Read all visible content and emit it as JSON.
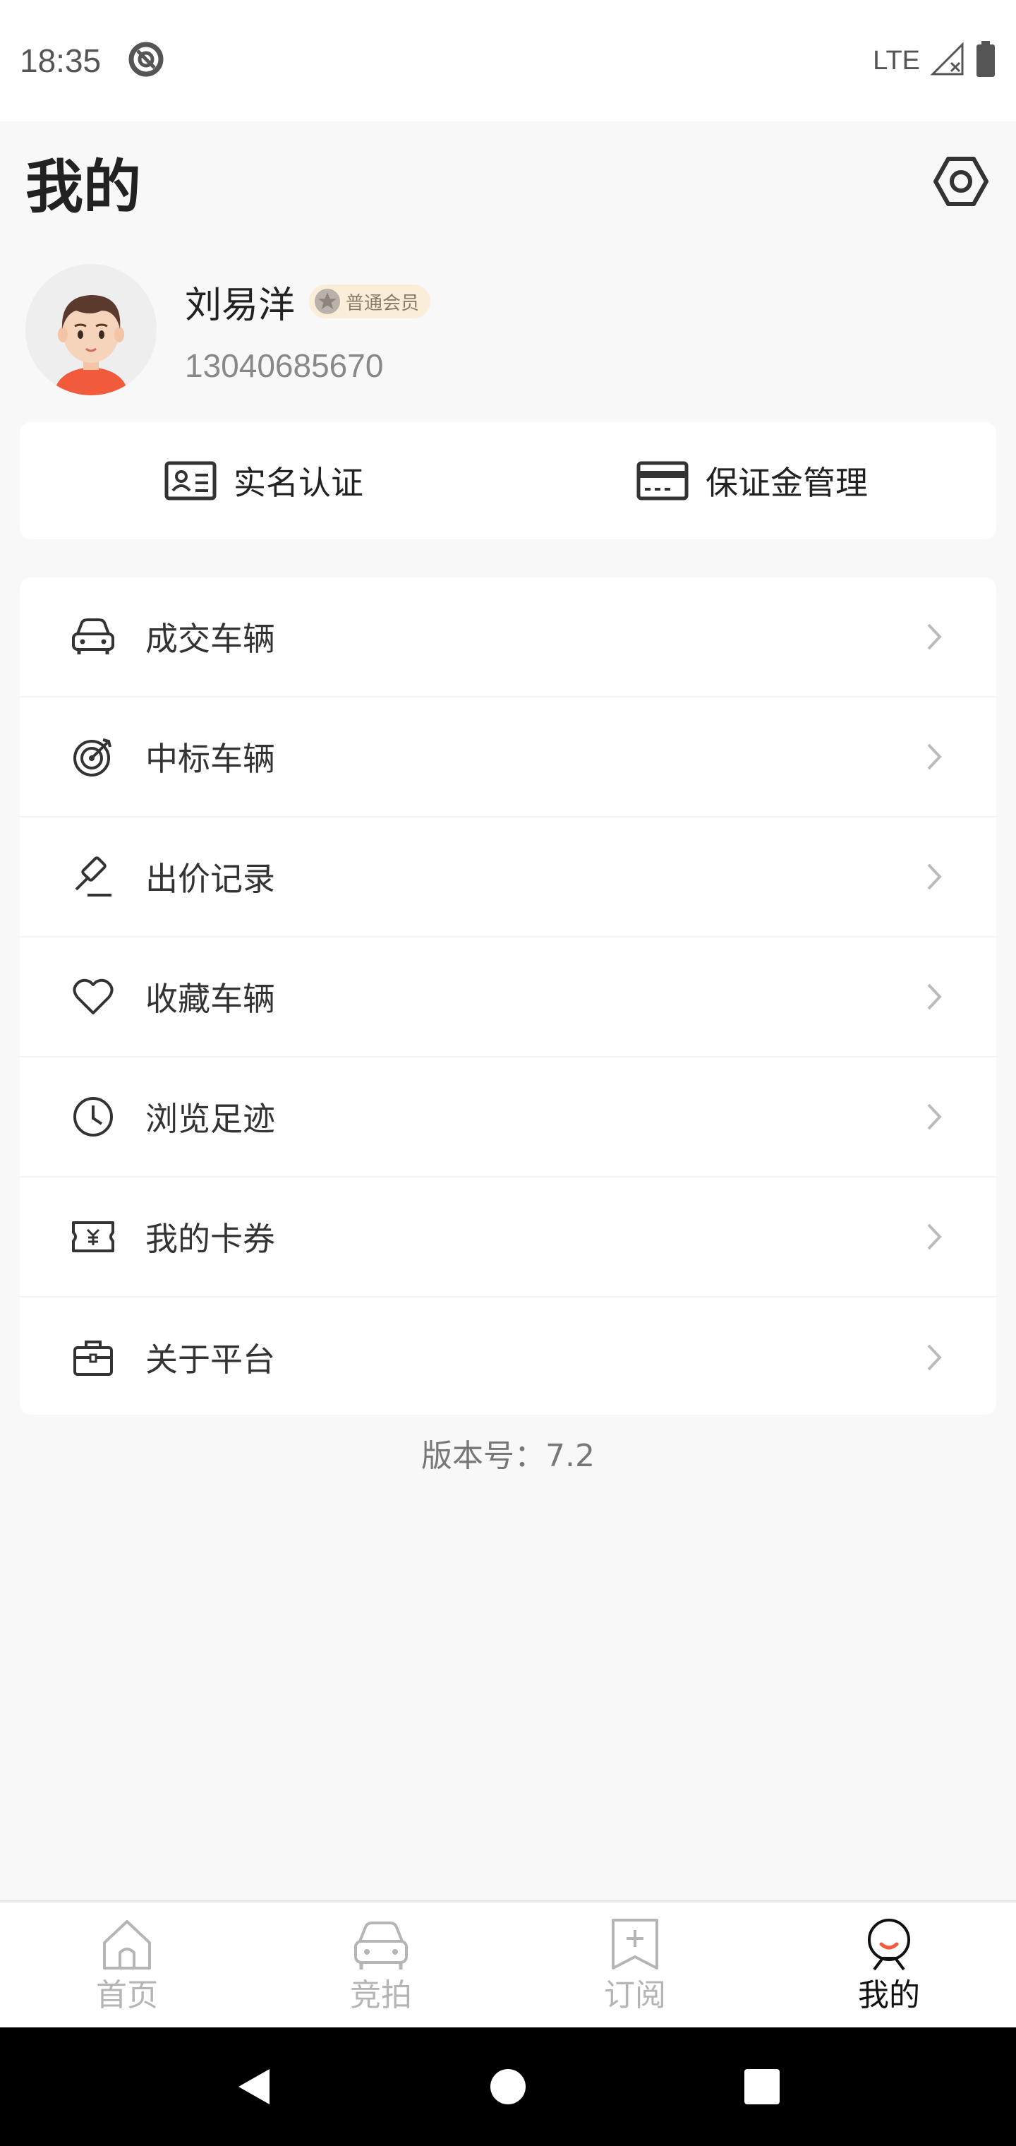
{
  "status_bar": {
    "time": "18:35",
    "network": "LTE"
  },
  "header": {
    "title": "我的"
  },
  "profile": {
    "name": "刘易洋",
    "member_level": "普通会员",
    "phone": "13040685670"
  },
  "quick_actions": [
    {
      "label": "实名认证",
      "icon": "id-card-icon"
    },
    {
      "label": "保证金管理",
      "icon": "credit-card-icon"
    }
  ],
  "menu": [
    {
      "label": "成交车辆",
      "icon": "car-icon"
    },
    {
      "label": "中标车辆",
      "icon": "target-icon"
    },
    {
      "label": "出价记录",
      "icon": "gavel-icon"
    },
    {
      "label": "收藏车辆",
      "icon": "heart-icon"
    },
    {
      "label": "浏览足迹",
      "icon": "clock-icon"
    },
    {
      "label": "我的卡券",
      "icon": "coupon-icon"
    },
    {
      "label": "关于平台",
      "icon": "briefcase-icon"
    }
  ],
  "version": "版本号：7.2",
  "tabs": [
    {
      "label": "首页",
      "icon": "home-icon",
      "active": false
    },
    {
      "label": "竞拍",
      "icon": "car-icon",
      "active": false
    },
    {
      "label": "订阅",
      "icon": "bookmark-add-icon",
      "active": false
    },
    {
      "label": "我的",
      "icon": "profile-smile-icon",
      "active": true
    }
  ],
  "colors": {
    "accent": "#f25a3c",
    "inactive_tab": "#b5b5b5",
    "badge_bg": "#fbeed8"
  }
}
